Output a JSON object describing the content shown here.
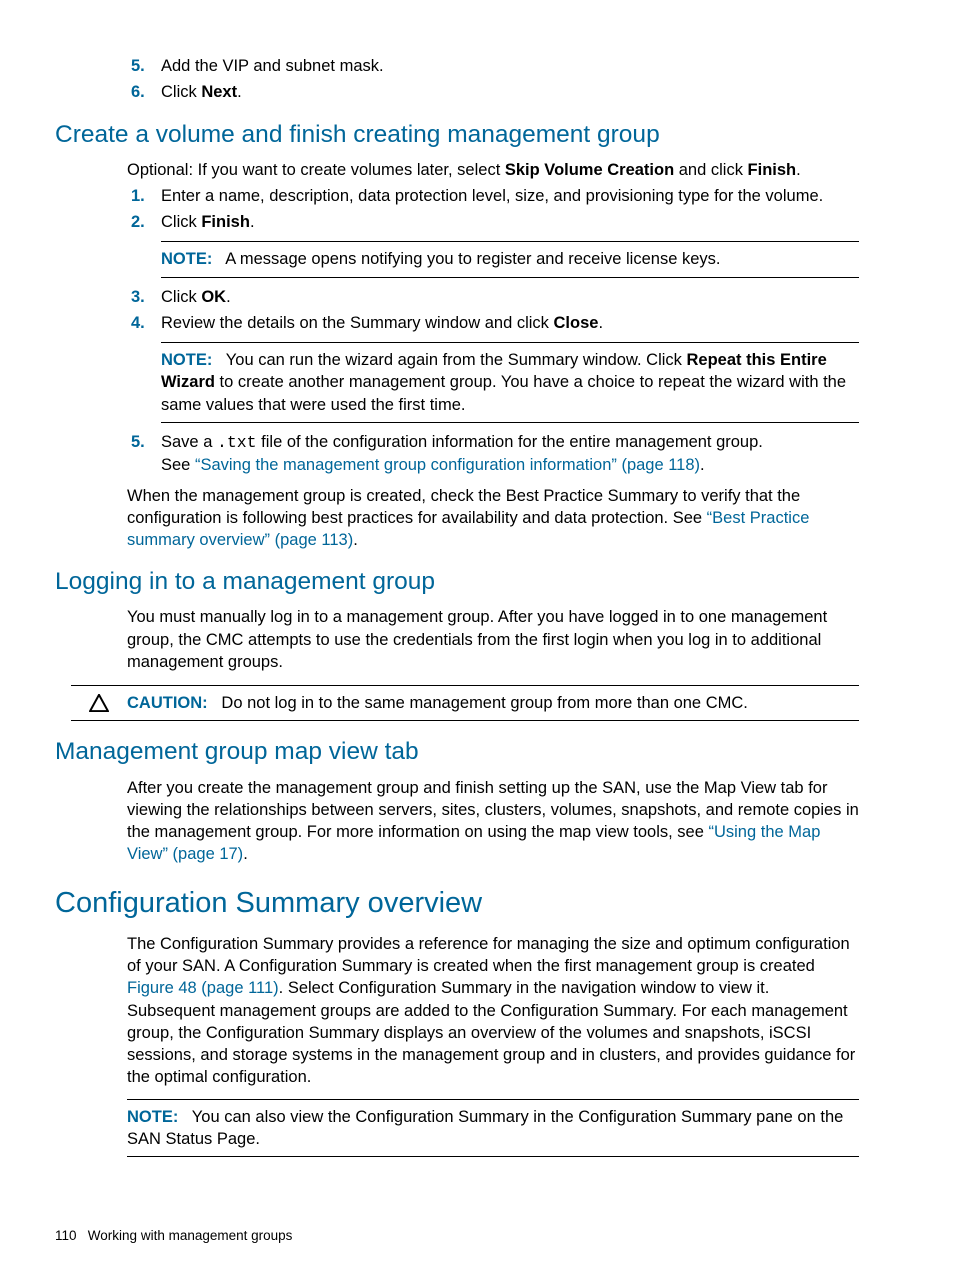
{
  "intro_steps": {
    "step5": {
      "num": "5.",
      "text": "Add the VIP and subnet mask."
    },
    "step6": {
      "num": "6.",
      "pre": "Click ",
      "bold": "Next",
      "post": "."
    }
  },
  "sec_create_volume": {
    "heading": "Create a volume and finish creating management group",
    "intro_pre": "Optional: If you want to create volumes later, select ",
    "intro_b1": "Skip Volume Creation",
    "intro_mid": " and click ",
    "intro_b2": "Finish",
    "intro_post": ".",
    "step1": {
      "num": "1.",
      "text": "Enter a name, description, data protection level, size, and provisioning type for the volume."
    },
    "step2": {
      "num": "2.",
      "pre": "Click ",
      "bold": "Finish",
      "post": "."
    },
    "note1": {
      "label": "NOTE:",
      "text": " A message opens notifying you to register and receive license keys."
    },
    "step3": {
      "num": "3.",
      "pre": "Click ",
      "bold": "OK",
      "post": "."
    },
    "step4": {
      "num": "4.",
      "pre": "Review the details on the Summary window and click ",
      "bold": "Close",
      "post": "."
    },
    "note2": {
      "label": "NOTE:",
      "t1": " You can run the wizard again from the Summary window. Click ",
      "b1": "Repeat this Entire Wizard",
      "t2": " to create another management group. You have a choice to repeat the wizard with the same values that were used the first time."
    },
    "step5": {
      "num": "5.",
      "t1": "Save a ",
      "mono": ".txt",
      "t2": " file of the configuration information for the entire management group.",
      "see_pre": "See ",
      "link": "“Saving the management group configuration information” (page 118)",
      "see_post": "."
    },
    "closing_t1": "When the management group is created, check the Best Practice Summary to verify that the configuration is following best practices for availability and data protection. See ",
    "closing_link": "“Best Practice summary overview” (page 113)",
    "closing_t2": "."
  },
  "sec_logging": {
    "heading": "Logging in to a management group",
    "para": "You must manually log in to a management group. After you have logged in to one management group, the CMC attempts to use the credentials from the first login when you log in to additional management groups.",
    "caution_label": "CAUTION:",
    "caution_text": " Do not log in to the same management group from more than one CMC."
  },
  "sec_mapview": {
    "heading": "Management group map view tab",
    "t1": "After you create the management group and finish setting up the SAN, use the Map View tab for viewing the relationships between servers, sites, clusters, volumes, snapshots, and remote copies in the management group. For more information on using the map view tools, see ",
    "link": "“Using the Map View” (page 17)",
    "t2": "."
  },
  "sec_config": {
    "heading": "Configuration Summary overview",
    "t1": "The Configuration Summary provides a reference for managing the size and optimum configuration of your SAN. A Configuration Summary is created when the first management group is created ",
    "link": "Figure 48 (page 111)",
    "t2": ". Select Configuration Summary in the navigation window to view it. Subsequent management groups are added to the Configuration Summary. For each management group, the Configuration Summary displays an overview of the volumes and snapshots, iSCSI sessions, and storage systems in the management group and in clusters, and provides guidance for the optimal configuration.",
    "note_label": "NOTE:",
    "note_text": " You can also view the Configuration Summary in the Configuration Summary pane on the SAN Status Page."
  },
  "footer": {
    "page": "110",
    "title": "Working with management groups"
  }
}
